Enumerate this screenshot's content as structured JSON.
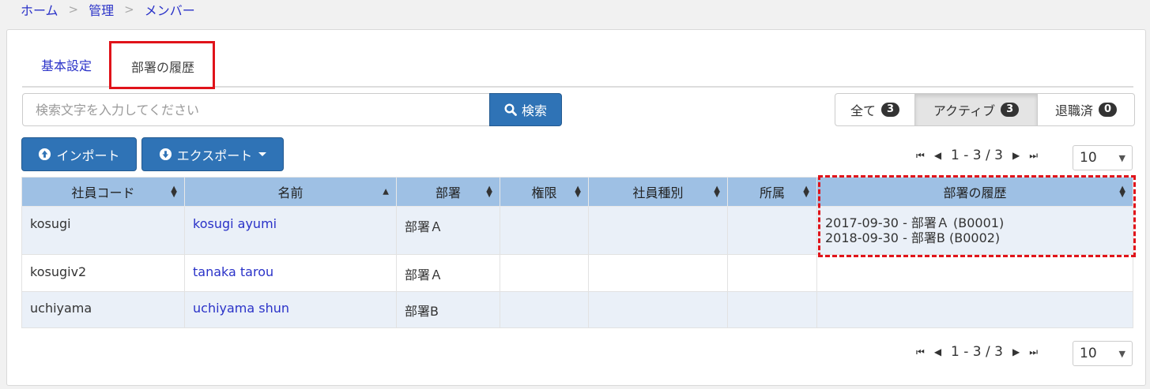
{
  "breadcrumb": {
    "home": "ホーム",
    "admin": "管理",
    "members": "メンバー",
    "separator": ">"
  },
  "tabs": {
    "basic": "基本設定",
    "history": "部署の履歴"
  },
  "search": {
    "placeholder": "検索文字を入力してください",
    "button_label": "検索"
  },
  "filters": [
    {
      "label": "全て",
      "count": "3",
      "active": false
    },
    {
      "label": "アクティブ",
      "count": "3",
      "active": true
    },
    {
      "label": "退職済",
      "count": "0",
      "active": false
    }
  ],
  "actions": {
    "import_label": "インポート",
    "export_label": "エクスポート"
  },
  "pagination": {
    "range": "1 - 3 / 3",
    "per_page": "10"
  },
  "table": {
    "headers": [
      "社員コード",
      "名前",
      "部署",
      "権限",
      "社員種別",
      "所属",
      "部署の履歴"
    ],
    "rows": [
      {
        "code": "kosugi",
        "name": "kosugi ayumi",
        "dept": "部署Ａ",
        "role": "",
        "type": "",
        "belong": "",
        "history": [
          "2017-09-30 - 部署Ａ (B0001)",
          "2018-09-30 - 部署B (B0002)"
        ]
      },
      {
        "code": "kosugiv2",
        "name": "tanaka tarou",
        "dept": "部署Ａ",
        "role": "",
        "type": "",
        "belong": "",
        "history": []
      },
      {
        "code": "uchiyama",
        "name": "uchiyama shun",
        "dept": "部署B",
        "role": "",
        "type": "",
        "belong": "",
        "history": []
      }
    ]
  },
  "colors": {
    "primary": "#2f73b6",
    "link": "#2a32c8",
    "header_bg": "#9ec0e4",
    "highlight": "#e0131a",
    "row_alt": "#eaf0f8"
  }
}
